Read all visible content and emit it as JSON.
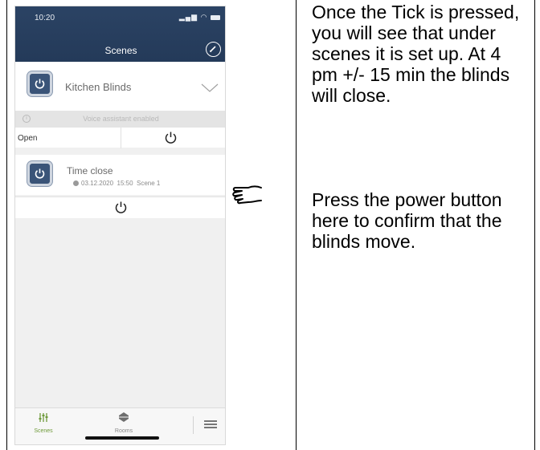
{
  "status_bar": {
    "time": "10:20"
  },
  "header": {
    "title": "Scenes"
  },
  "scene_card": {
    "name": "Kitchen Blinds"
  },
  "voice_bar": {
    "info_glyph": "i",
    "text": "Voice assistant enabled"
  },
  "action_row": {
    "label": "Open"
  },
  "time_card": {
    "name": "Time close",
    "date": "03.12.2020",
    "time": "15:50",
    "scene": "Scene 1"
  },
  "tabbar": {
    "scenes_label": "Scenes",
    "rooms_label": "Rooms"
  },
  "instructions": {
    "text_1": "Once the Tick is pressed, you will see that under scenes it is set up. At 4 pm +/- 15 min the blinds will close.",
    "text_2": "Press the power button here to confirm that the blinds move."
  },
  "colors": {
    "header": "#243a59",
    "accent": "#6e9a3a",
    "scene_icon": "#3a5478"
  },
  "icons": [
    "edit-icon",
    "power-icon",
    "chevron-down-icon",
    "info-icon",
    "clock-icon",
    "scenes-tab-icon",
    "rooms-tab-icon",
    "menu-icon",
    "pointing-hand-icon"
  ]
}
